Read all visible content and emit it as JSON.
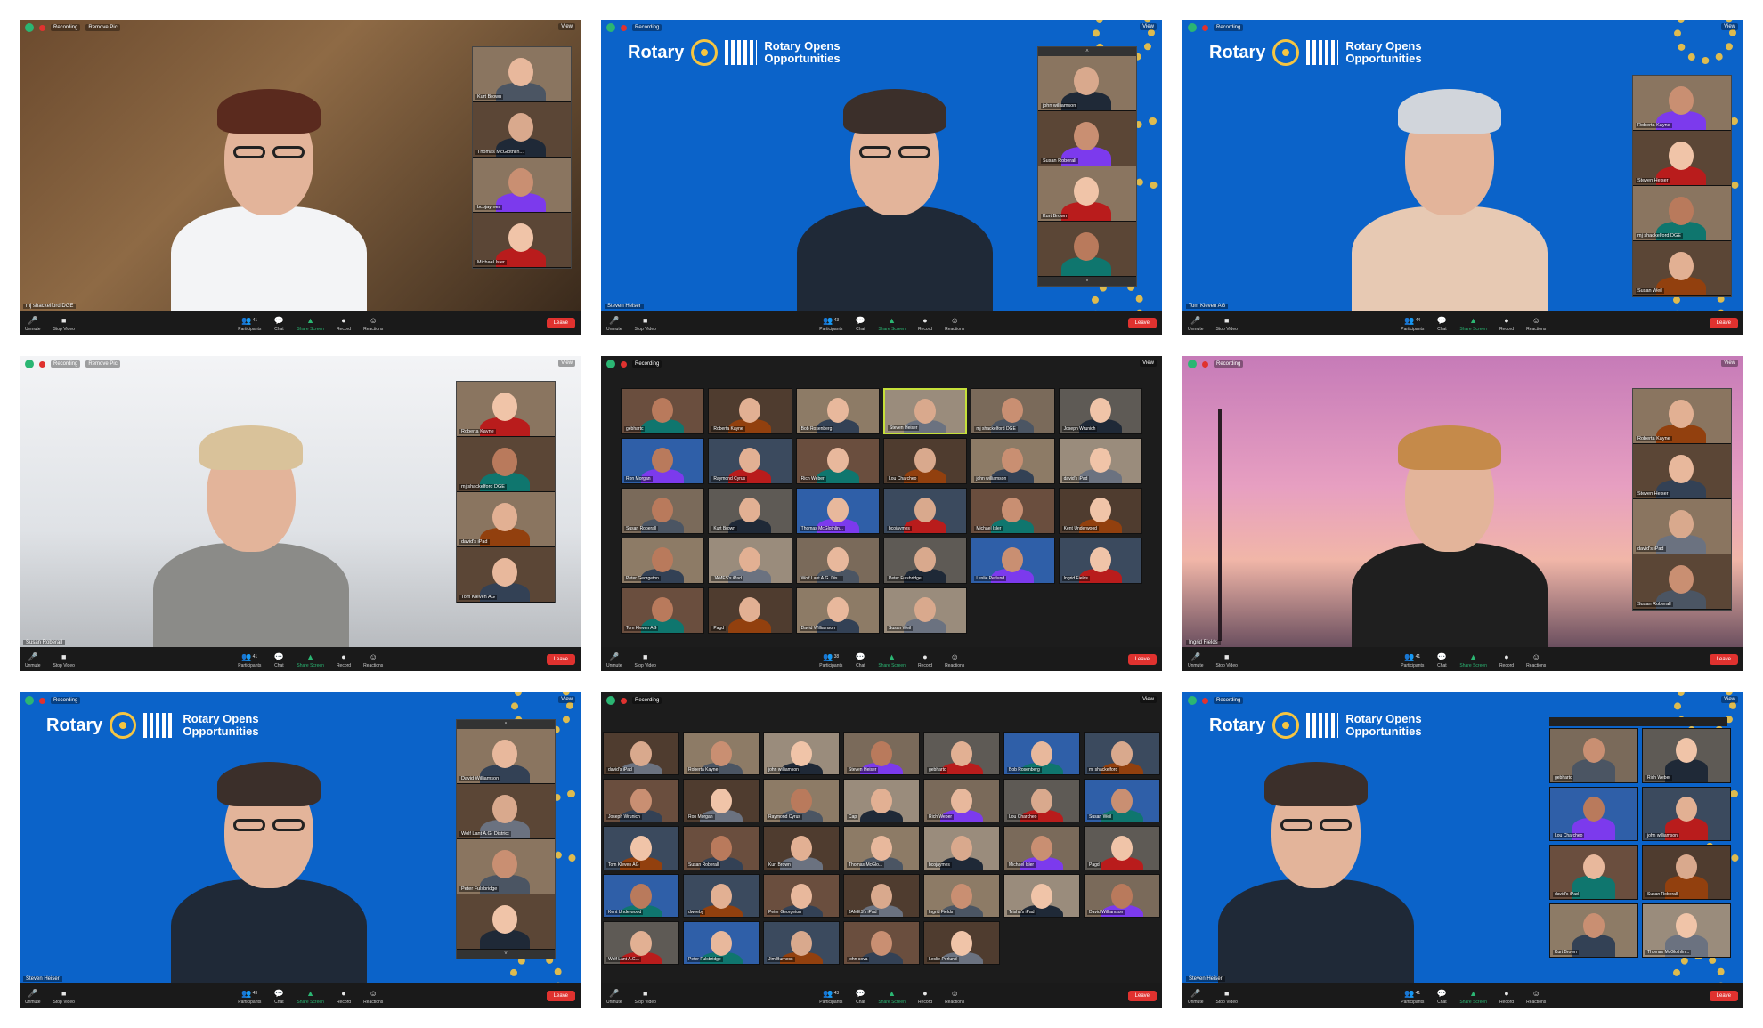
{
  "toolbar": {
    "unmute": "Unmute",
    "stop_video": "Stop Video",
    "participants": "Participants",
    "chat": "Chat",
    "share_screen": "Share Screen",
    "record": "Record",
    "reactions": "Reactions",
    "leave": "Leave"
  },
  "common": {
    "recording": "Recording",
    "view": "View",
    "remove_pic": "Remove Pic"
  },
  "banner": {
    "rotary": "Rotary",
    "opens": "Rotary Opens\nOpportunities"
  },
  "shots": [
    {
      "participants_count": "41",
      "main_name": "mj shackelford DGE",
      "thumbs": [
        "Kurt Brown",
        "Thomas McGlothlin...",
        "bcojaymes",
        "Michael Isler"
      ]
    },
    {
      "participants_count": "43",
      "main_name": "Steven Heiser",
      "thumbs": [
        "john williamson",
        "Susan Roberall",
        "Kurt Brown",
        ""
      ]
    },
    {
      "participants_count": "44",
      "main_name": "Tom Kleven AG",
      "thumbs": [
        "Roberta Kayne",
        "Steven Heiser",
        "mj shackelford DGE",
        "Susan Weil"
      ]
    },
    {
      "participants_count": "41",
      "main_name": "Susan Roberall",
      "thumbs": [
        "Roberta Kayne",
        "mj shackelford DGE",
        "david's iPad",
        "Tom Kleven AG"
      ]
    },
    {
      "participants_count": "38",
      "main_name": "",
      "gallery": [
        "gebhartc",
        "Roberta Kayne",
        "Bob Rosenberg",
        "Steven Heiser",
        "mj shackelford DGE",
        "Joseph Wrunich",
        "Ron Morgan",
        "Raymond Cyrus",
        "Rich Weber",
        "Lou Charcheo",
        "john williamson",
        "david's iPad",
        "Susan Roberall",
        "Kurt Brown",
        "Thomas McGlothlin...",
        "bcojaymes",
        "Michael Isler",
        "Kent Underwood",
        "Peter Georgeton",
        "JAMES's iPad",
        "Wolf Lant A.G. Dis...",
        "Peter Fulsbridge",
        "Leslie Perlund",
        "Ingrid Fields",
        "Tom Kleven AG",
        "Pagd",
        "David Williamson",
        "Susan Weil"
      ]
    },
    {
      "participants_count": "41",
      "main_name": "Ingrid Fields",
      "thumbs": [
        "Roberta Kayne",
        "Steven Heiser",
        "david's iPad",
        "Susan Roberall"
      ]
    },
    {
      "participants_count": "43",
      "main_name": "Steven Heiser",
      "thumbs": [
        "David Williamson",
        "Wolf Lant A.G. District",
        "Peter Fulsbridge",
        ""
      ]
    },
    {
      "participants_count": "43",
      "main_name": "",
      "gallery": [
        "david's iPad",
        "Roberta Kayne",
        "john williamson",
        "Steven Heiser",
        "gebhartc",
        "Bob Rosenberg",
        "mj shackelford",
        "Joseph Wrunich",
        "Ron Morgan",
        "Raymond Cyrus",
        "Cap",
        "Rich Weber",
        "Lou Charcheo",
        "Susan Weil",
        "Tom Kleven AG",
        "Susan Roberall",
        "Kurt Brown",
        "Thomas McGlo...",
        "bcojaymes",
        "Michael Isler",
        "Pagd",
        "Kent Underwood",
        "dweeby",
        "Peter Georgeton",
        "JAMES's iPad",
        "Ingrid Fields",
        "Trisha's iPad",
        "David Williamson",
        "Wolf Lant A.G...",
        "Peter Fulsbridge",
        "Jim Burness",
        "john sova",
        "Leslie Perlund"
      ]
    },
    {
      "participants_count": "41",
      "main_name": "Steven Heiser",
      "gallery": [
        "gebhartc",
        "Rich Weber",
        "Lou Charcheo",
        "john williamson",
        "david's iPad",
        "Susan Roberall",
        "Kurt Brown",
        "Thomas McGlothlin..."
      ]
    }
  ]
}
